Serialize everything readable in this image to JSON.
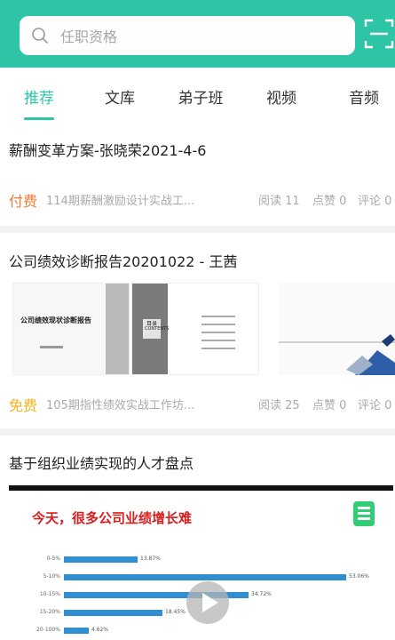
{
  "search": {
    "placeholder": "任职资格"
  },
  "colors": {
    "accent": "#2dc5a6",
    "paid": "#f07a3a",
    "free": "#f2b21d",
    "bar": "#2f8fd1"
  },
  "tabs": [
    {
      "label": "推荐",
      "active": true
    },
    {
      "label": "文库",
      "active": false
    },
    {
      "label": "弟子班",
      "active": false
    },
    {
      "label": "视频",
      "active": false
    },
    {
      "label": "音频",
      "active": false
    }
  ],
  "feed": [
    {
      "title": "薪酬变革方案-张晓荣2021-4-6",
      "price": "付费",
      "course": "114期薪酬激励设计实战工...",
      "reads": "阅读 11",
      "likes": "点赞 0",
      "comments": "评论 0"
    },
    {
      "title": "公司绩效诊断报告20201022 - 王茜",
      "slides": {
        "s1_title": "公司绩效现状诊断报告",
        "s2_title": "目录",
        "s2_sub": "CONTENTS"
      },
      "price": "免费",
      "course": "105期指性绩效实战工作坊...",
      "reads": "阅读 25",
      "likes": "点赞 0",
      "comments": "评论 0"
    },
    {
      "title": "基于组织业绩实现的人才盘点",
      "thumb_headline": "今天，很多公司业绩增长难",
      "thumb_logo": "logo-icon",
      "bars": [
        {
          "label": "0-5%",
          "value": 13.87,
          "text": "13.87%"
        },
        {
          "label": "5-10%",
          "value": 53.06,
          "text": "53.06%"
        },
        {
          "label": "10-15%",
          "value": 34.72,
          "text": "34.72%"
        },
        {
          "label": "15-20%",
          "value": 18.45,
          "text": "18.45%"
        },
        {
          "label": "20-100%",
          "value": 4.62,
          "text": "4.62%"
        }
      ]
    }
  ]
}
